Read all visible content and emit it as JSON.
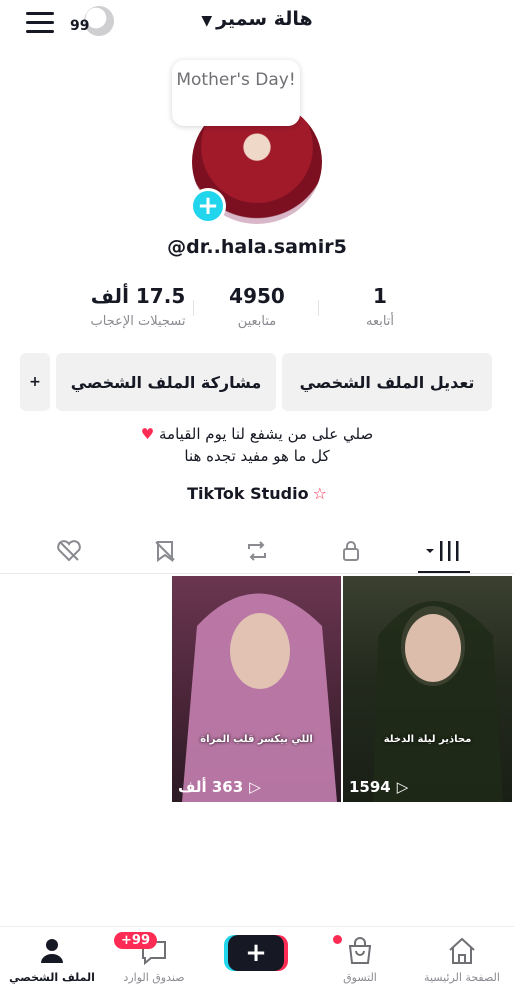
{
  "header": {
    "username": "هالة سمير",
    "notification_count": "99"
  },
  "profile": {
    "bubble_note": "Mother's Day!",
    "handle": "@dr..hala.samir5"
  },
  "stats": [
    {
      "value": "17.5 ألف",
      "label": "تسجيلات الإعجاب"
    },
    {
      "value": "4950",
      "label": "متابعين"
    },
    {
      "value": "1",
      "label": "أتابعه"
    }
  ],
  "buttons": {
    "edit": "تعديل الملف الشخصي",
    "share": "مشاركة الملف الشخصي"
  },
  "bio": {
    "line1": "صلي على من يشفع لنا يوم القيامة",
    "line2": "كل ما هو مفيد تجده هنا"
  },
  "studio": {
    "label": "TikTok Studio"
  },
  "tabs": [
    "liked-hidden",
    "favorites-hidden",
    "reposts",
    "private",
    "videos-grid"
  ],
  "videos": [
    {
      "caption": "محاذير ليلة الدخلة",
      "views": "1594",
      "bg": "#2d3326"
    },
    {
      "caption": "اللي بيكسر قلب المراة",
      "views": "363 ألف",
      "bg": "#b97aa8"
    }
  ],
  "nav": {
    "home": "الصفحة الرئيسية",
    "shop": "التسوق",
    "inbox": "صندوق الوارد",
    "inbox_badge": "+99",
    "profile": "الملف الشخصي"
  },
  "colors": {
    "accent_red": "#fe2c55",
    "accent_cyan": "#20d5ec",
    "text": "#161823"
  }
}
